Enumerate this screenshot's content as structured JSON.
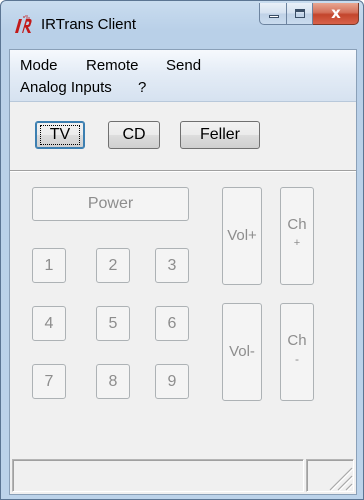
{
  "window": {
    "title": "IRTrans Client",
    "icon": "irtrans-logo-icon"
  },
  "caption_buttons": {
    "minimize": "minimize-icon",
    "maximize": "maximize-icon",
    "close_glyph": "x"
  },
  "menu": {
    "row1": [
      "Mode",
      "Remote",
      "Send"
    ],
    "row2": [
      "Analog Inputs",
      "?"
    ]
  },
  "remotes": {
    "items": [
      "TV",
      "CD",
      "Feller"
    ],
    "selected": "TV"
  },
  "keypad": {
    "power": "Power",
    "digits": [
      "1",
      "2",
      "3",
      "4",
      "5",
      "6",
      "7",
      "8",
      "9"
    ],
    "vol_up": "Vol+",
    "vol_down": "Vol-",
    "ch_up_label": "Ch",
    "ch_up_sign": "+",
    "ch_down_label": "Ch",
    "ch_down_sign": "-"
  },
  "colors": {
    "title_bar": "#c9dcef",
    "close_button": "#c3452c",
    "disabled_text": "#8d8d8d",
    "focus": "#3c7fb1"
  }
}
